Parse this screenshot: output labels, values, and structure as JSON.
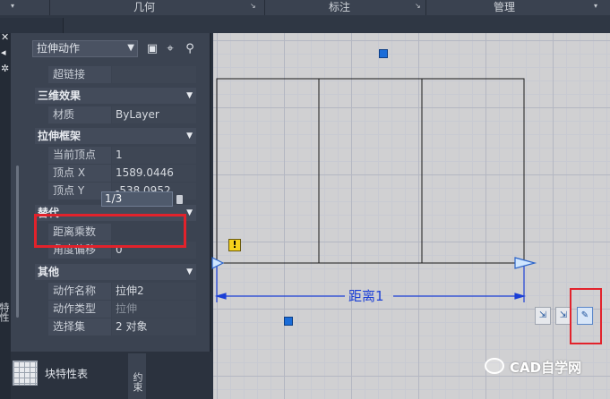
{
  "ribbon": {
    "panels": [
      {
        "label": "",
        "arrow": "▾"
      },
      {
        "label": "几何",
        "arrow": "↘"
      },
      {
        "label": "标注",
        "arrow": "↘"
      },
      {
        "label": "管理",
        "arrow": "▾"
      }
    ]
  },
  "palette": {
    "selected_object": "拉伸动作",
    "sections": [
      {
        "title": "三维效果",
        "rows": [
          {
            "key": "材质",
            "value": "ByLayer"
          }
        ]
      },
      {
        "title": "拉伸框架",
        "rows": [
          {
            "key": "当前顶点",
            "value": "1"
          },
          {
            "key": "顶点 X",
            "value": "1589.0446"
          },
          {
            "key": "顶点 Y",
            "value": "-538.0952"
          }
        ]
      },
      {
        "title": "替代",
        "rows": [
          {
            "key": "距离乘数",
            "value": "1/3"
          },
          {
            "key": "角度偏移",
            "value": "0"
          }
        ]
      },
      {
        "title": "其他",
        "rows": [
          {
            "key": "动作名称",
            "value": "拉伸2"
          },
          {
            "key": "动作类型",
            "value": "拉伸"
          },
          {
            "key": "选择集",
            "value": "2 对象"
          }
        ]
      }
    ],
    "hyperlink_row": {
      "key": "超链接",
      "value": ""
    }
  },
  "bottom": {
    "block_table_label": "块特性表",
    "vertical_tab_label": "约束",
    "side_label": "特性"
  },
  "canvas": {
    "dimension_label": "距离1",
    "warning_glyph": "!"
  },
  "watermark": {
    "text": "CAD自学网"
  },
  "colors": {
    "highlight_red": "#e2222b",
    "grip_blue": "#1a6cd8",
    "dimension_blue": "#1b3fd6",
    "canvas_bg": "#d0d0d2"
  }
}
